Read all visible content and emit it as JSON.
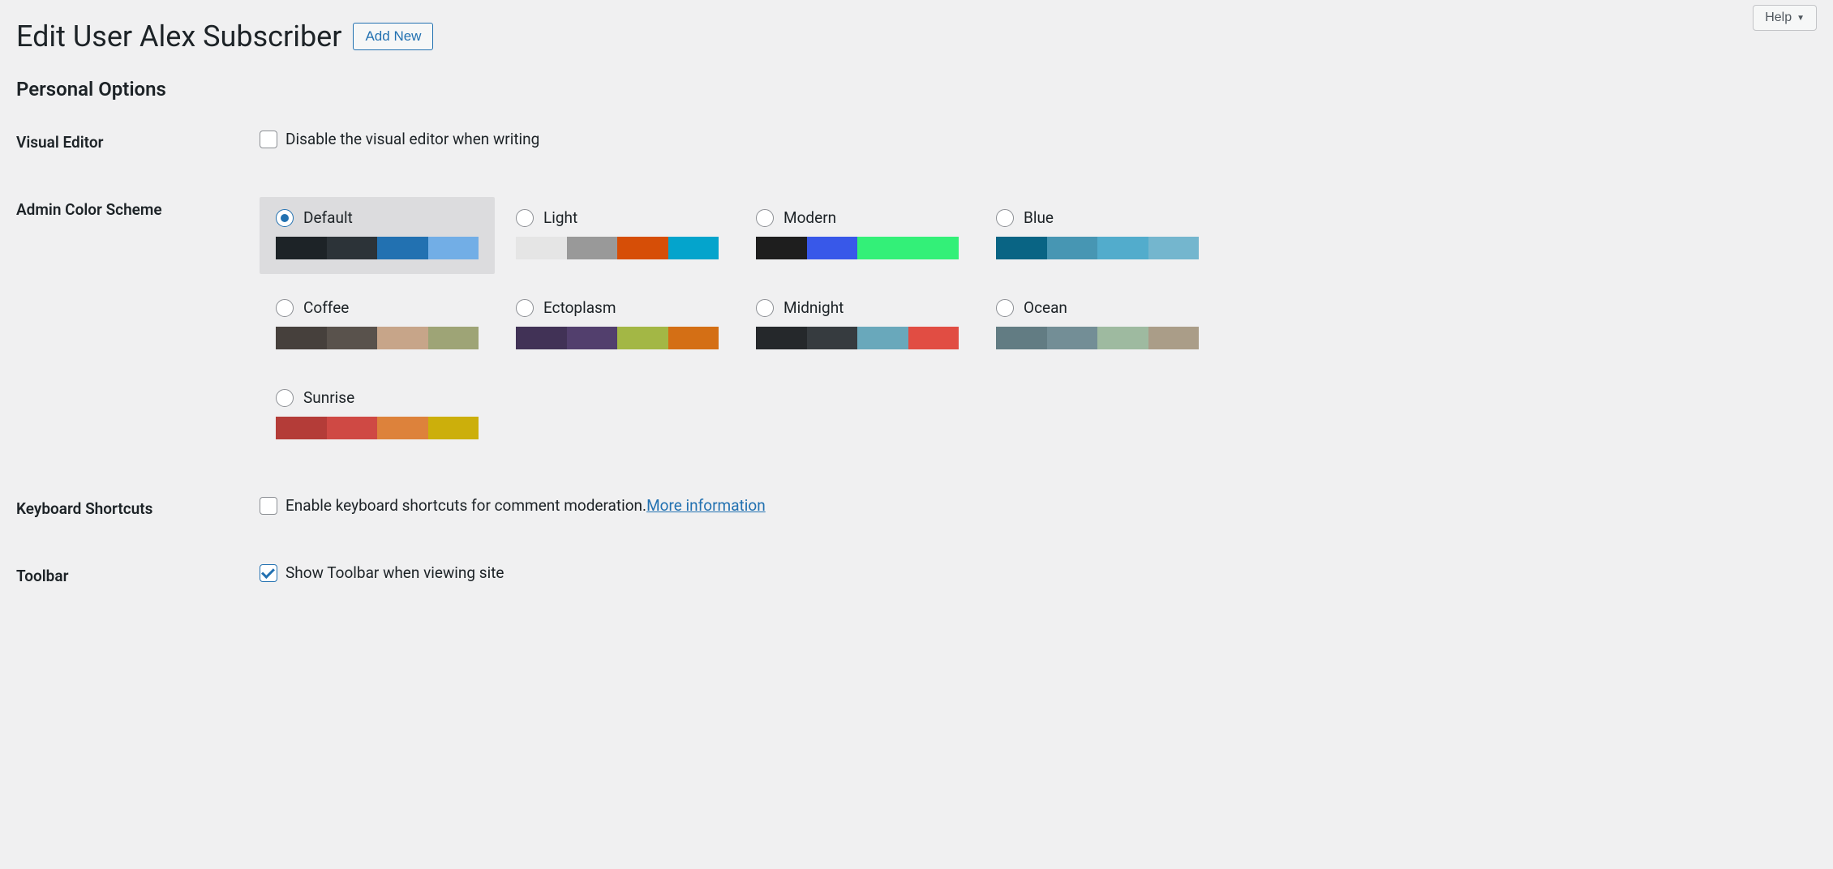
{
  "help_label": "Help",
  "page_title": "Edit User Alex Subscriber",
  "add_new_label": "Add New",
  "section_title": "Personal Options",
  "rows": {
    "visual_editor": {
      "th": "Visual Editor",
      "checkbox_label": "Disable the visual editor when writing"
    },
    "admin_color": {
      "th": "Admin Color Scheme"
    },
    "keyboard": {
      "th": "Keyboard Shortcuts",
      "checkbox_label": "Enable keyboard shortcuts for comment moderation. ",
      "more_link": "More information"
    },
    "toolbar": {
      "th": "Toolbar",
      "checkbox_label": "Show Toolbar when viewing site"
    }
  },
  "color_schemes": [
    {
      "label": "Default",
      "selected": true,
      "colors": [
        "#1d2327",
        "#2c3338",
        "#2271b1",
        "#72aee6"
      ]
    },
    {
      "label": "Light",
      "selected": false,
      "colors": [
        "#e5e5e5",
        "#999999",
        "#d64e07",
        "#04a4cc"
      ]
    },
    {
      "label": "Modern",
      "selected": false,
      "colors": [
        "#1e1e1e",
        "#3858e9",
        "#33f078",
        "#33f078"
      ]
    },
    {
      "label": "Blue",
      "selected": false,
      "colors": [
        "#096484",
        "#4796b3",
        "#52accc",
        "#74b6ce"
      ]
    },
    {
      "label": "Coffee",
      "selected": false,
      "colors": [
        "#46403c",
        "#59524c",
        "#c7a589",
        "#9ea476"
      ]
    },
    {
      "label": "Ectoplasm",
      "selected": false,
      "colors": [
        "#413256",
        "#523f6d",
        "#a3b745",
        "#d46f15"
      ]
    },
    {
      "label": "Midnight",
      "selected": false,
      "colors": [
        "#25282b",
        "#363b3f",
        "#69a8bb",
        "#e14d43"
      ]
    },
    {
      "label": "Ocean",
      "selected": false,
      "colors": [
        "#627c83",
        "#738e96",
        "#9ebaa0",
        "#aa9d88"
      ]
    },
    {
      "label": "Sunrise",
      "selected": false,
      "colors": [
        "#b43c38",
        "#cf4944",
        "#dd823b",
        "#ccaf0b"
      ]
    }
  ]
}
